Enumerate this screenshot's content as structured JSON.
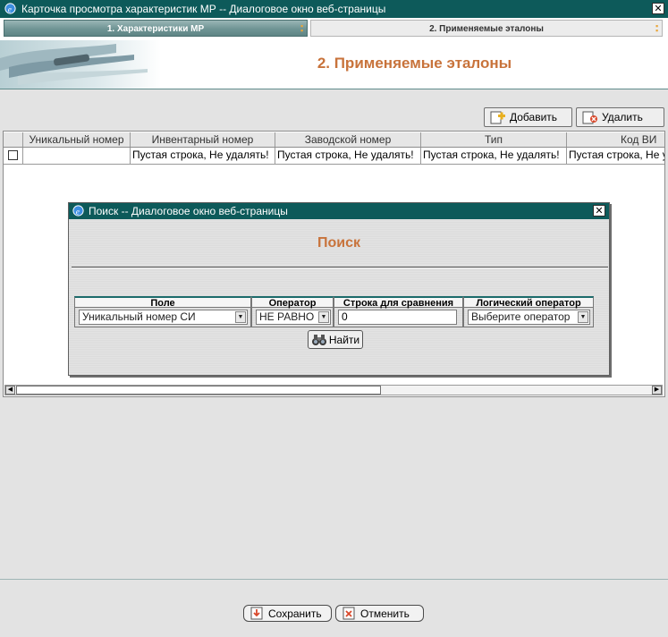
{
  "window": {
    "title": "Карточка просмотра характеристик МР -- Диалоговое окно веб-страницы",
    "close": "✕"
  },
  "tabs": [
    {
      "label": "1. Характеристики МР",
      "dots": "▪ ▪"
    },
    {
      "label": "2. Применяемые эталоны",
      "dots": "▪ ▪"
    }
  ],
  "header": {
    "title": "2. Применяемые эталоны"
  },
  "toolbar": {
    "add_label": "Добавить",
    "delete_label": "Удалить"
  },
  "grid": {
    "columns": [
      "Уникальный номер",
      "Инвентарный номер",
      "Заводской номер",
      "Тип",
      "Код ВИ"
    ],
    "row": [
      "",
      "Пустая строка, Не удалять!",
      "Пустая строка, Не удалять!",
      "Пустая строка, Не удалять!",
      "Пустая строка, Не удалять!"
    ]
  },
  "dialog": {
    "title": "Поиск -- Диалоговое окно веб-страницы",
    "heading": "Поиск",
    "columns": [
      "Поле",
      "Оператор",
      "Строка для сравнения",
      "Логический оператор"
    ],
    "field_value": "Уникальный номер СИ",
    "operator_value": "НЕ РАВНО",
    "compare_value": "0",
    "logic_value": "Выберите оператор",
    "find_label": "Найти"
  },
  "footer": {
    "save_label": "Сохранить",
    "cancel_label": "Отменить"
  },
  "colors": {
    "titlebar": "#0d5a5a",
    "accent": "#c8733b",
    "tab": "#6f9494"
  }
}
